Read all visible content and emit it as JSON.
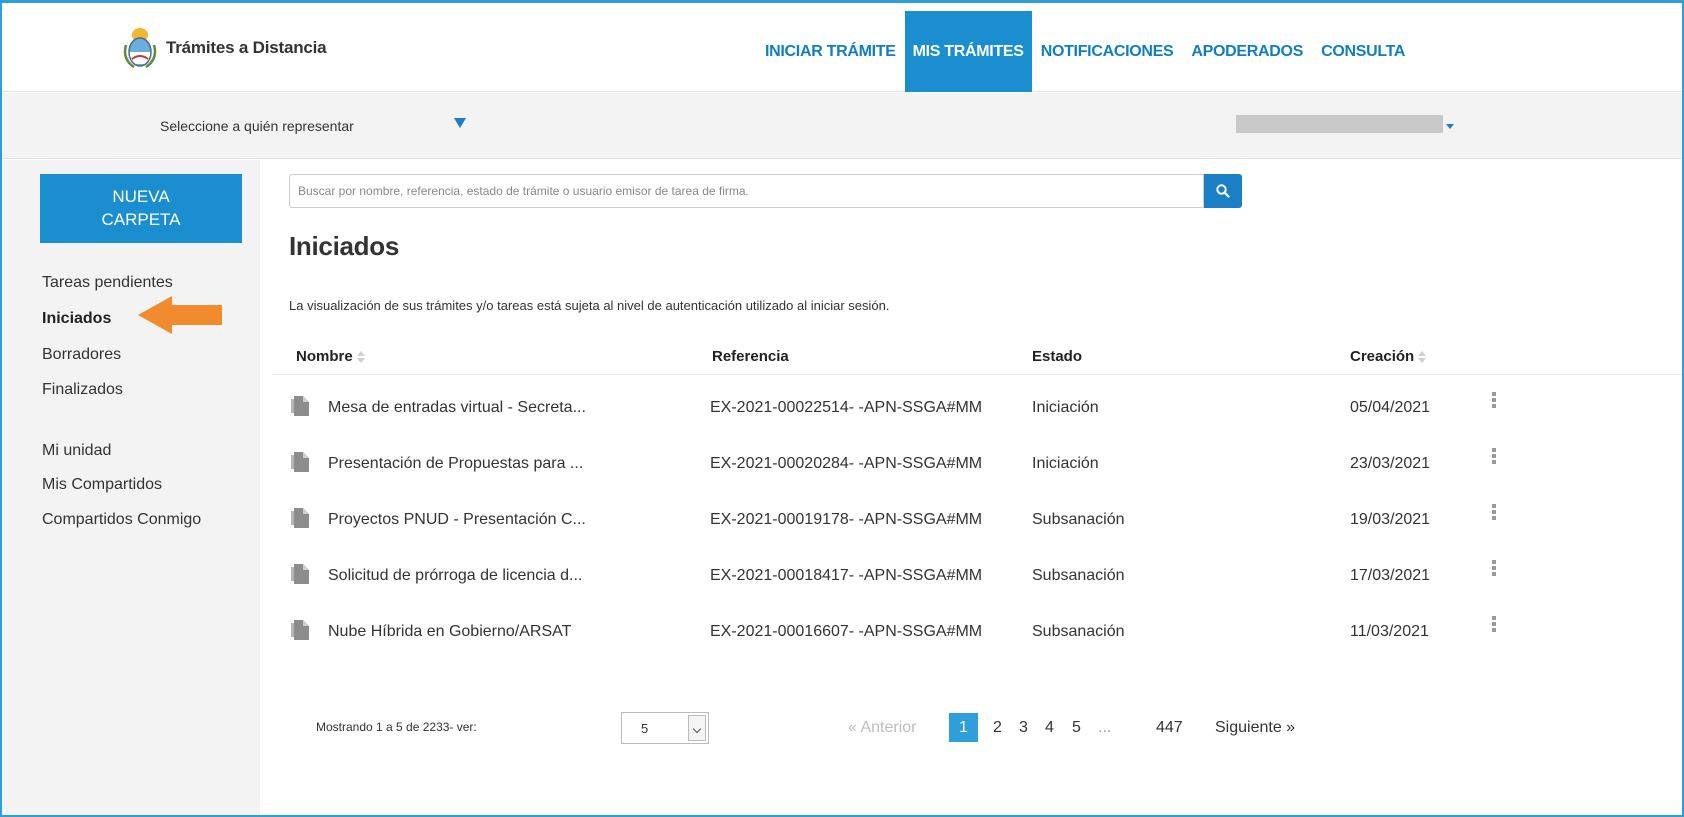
{
  "header": {
    "brand_name": "Trámites a Distancia",
    "nav": [
      {
        "label": "INICIAR TRÁMITE",
        "active": false
      },
      {
        "label": "MIS TRÁMITES",
        "active": true
      },
      {
        "label": "NOTIFICACIONES",
        "active": false
      },
      {
        "label": "APODERADOS",
        "active": false
      },
      {
        "label": "CONSULTA",
        "active": false
      }
    ]
  },
  "represent": {
    "label": "Seleccione a quién representar"
  },
  "sidebar": {
    "new_folder_line1": "NUEVA",
    "new_folder_line2": "CARPETA",
    "items": [
      {
        "label": "Tareas pendientes"
      },
      {
        "label": "Iniciados"
      },
      {
        "label": "Borradores"
      },
      {
        "label": "Finalizados"
      },
      {
        "label": "Mi unidad"
      },
      {
        "label": "Mis Compartidos"
      },
      {
        "label": "Compartidos Conmigo"
      }
    ]
  },
  "search": {
    "placeholder": "Buscar por nombre, referencia, estado de trámite o usuario emisor de tarea de firma."
  },
  "main": {
    "title": "Iniciados",
    "notice": "La visualización de sus trámites y/o tareas está sujeta al nivel de autenticación utilizado al iniciar sesión.",
    "columns": [
      "Nombre",
      "Referencia",
      "Estado",
      "Creación"
    ],
    "rows": [
      {
        "nombre": "Mesa de entradas virtual - Secreta...",
        "referencia": "EX-2021-00022514- -APN-SSGA#MM",
        "estado": "Iniciación",
        "creacion": "05/04/2021"
      },
      {
        "nombre": "Presentación de Propuestas para ...",
        "referencia": "EX-2021-00020284- -APN-SSGA#MM",
        "estado": "Iniciación",
        "creacion": "23/03/2021"
      },
      {
        "nombre": "Proyectos PNUD - Presentación C...",
        "referencia": "EX-2021-00019178- -APN-SSGA#MM",
        "estado": "Subsanación",
        "creacion": "19/03/2021"
      },
      {
        "nombre": "Solicitud de prórroga de licencia d...",
        "referencia": "EX-2021-00018417- -APN-SSGA#MM",
        "estado": "Subsanación",
        "creacion": "17/03/2021"
      },
      {
        "nombre": "Nube Híbrida en Gobierno/ARSAT",
        "referencia": "EX-2021-00016607- -APN-SSGA#MM",
        "estado": "Subsanación",
        "creacion": "11/03/2021"
      }
    ]
  },
  "footer": {
    "showing": "Mostrando 1 a 5 de 2233- ver:",
    "page_size": "5",
    "prev": "« Anterior",
    "pages": [
      "1",
      "2",
      "3",
      "4",
      "5"
    ],
    "ellipsis": "...",
    "last_page": "447",
    "next": "Siguiente »"
  },
  "colors": {
    "accent": "#1a8ecf",
    "link": "#0f7fc1",
    "arrow": "#f28a2e"
  }
}
